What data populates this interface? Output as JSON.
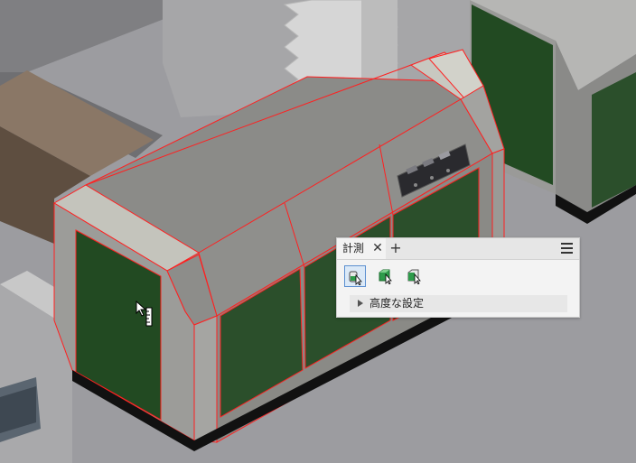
{
  "measure_panel": {
    "tab_title": "計測",
    "close_glyph": "✕",
    "add_glyph": "+",
    "tools": [
      {
        "name": "select-component-icon",
        "active": true
      },
      {
        "name": "select-part-icon",
        "active": false
      },
      {
        "name": "select-face-icon",
        "active": false
      }
    ],
    "advanced_label": "高度な設定"
  },
  "colors": {
    "selection_edge": "#ff0000",
    "enclosure_top": "#8a8a87",
    "door_panel": "#2b4f2b",
    "background": "#9c9ca0"
  }
}
